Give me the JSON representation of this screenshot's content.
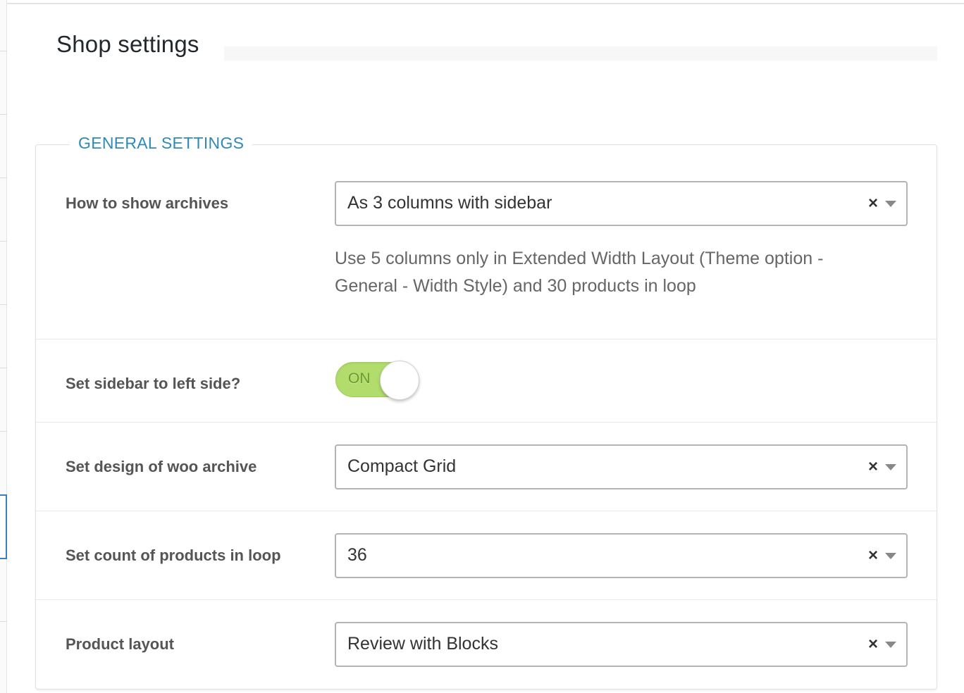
{
  "page": {
    "title": "Shop settings"
  },
  "section": {
    "legend": "GENERAL SETTINGS"
  },
  "fields": {
    "archives": {
      "label": "How to show archives",
      "value": "As 3 columns with sidebar",
      "clear": "×",
      "help": "Use 5 columns only in Extended Width Layout (Theme option - General - Width Style) and 30 products in loop"
    },
    "sidebar_left": {
      "label": "Set sidebar to left side?",
      "toggle_text": "ON",
      "state": "on"
    },
    "archive_design": {
      "label": "Set design of woo archive",
      "value": "Compact Grid",
      "clear": "×"
    },
    "products_count": {
      "label": "Set count of products in loop",
      "value": "36",
      "clear": "×"
    },
    "product_layout": {
      "label": "Product layout",
      "value": "Review with Blocks",
      "clear": "×"
    }
  },
  "colors": {
    "accent": "#2f8ab5",
    "toggle_on": "#b2dd6c"
  }
}
